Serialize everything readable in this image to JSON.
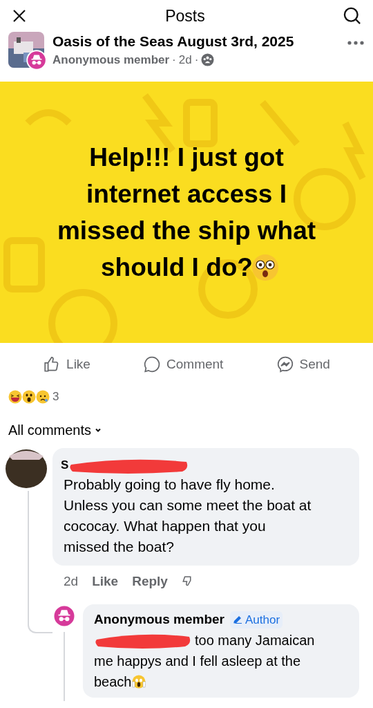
{
  "header": {
    "title": "Posts"
  },
  "post": {
    "group": "Oasis of the Seas August 3rd, 2025",
    "author": "Anonymous member",
    "meta_sep": "·",
    "time": "2d",
    "text_lines": [
      "Help!!! I just got",
      "internet access I",
      "missed the ship what",
      "should I do?"
    ]
  },
  "actions": [
    {
      "kind": "like",
      "label": "Like"
    },
    {
      "kind": "comment",
      "label": "Comment"
    },
    {
      "kind": "send",
      "label": "Send"
    }
  ],
  "reactions": {
    "count": "3"
  },
  "comments_filter": "All comments",
  "comments": [
    {
      "author_visible": "S",
      "text_lines": [
        "Probably going to have fly home.",
        "Unless you can some meet the boat at",
        "cococay. What happen that you",
        "missed the boat?"
      ],
      "time": "2d",
      "like": "Like",
      "reply": "Reply"
    }
  ],
  "reply": {
    "author": "Anonymous member",
    "badge": "Author",
    "text_after_redaction": "too many Jamaican",
    "text_line2": "me happys and I fell asleep at the",
    "text_line3": "beach"
  }
}
